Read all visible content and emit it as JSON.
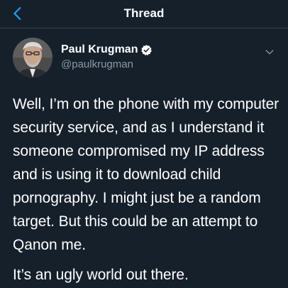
{
  "header": {
    "title": "Thread",
    "back_icon": "chevron-left-icon",
    "accent_color": "#1da1f2"
  },
  "author": {
    "display_name": "Paul Krugman",
    "handle": "@paulkrugman",
    "verified": true,
    "verified_icon": "verified-badge-icon",
    "caret_icon": "chevron-down-icon"
  },
  "tweet": {
    "paragraphs": [
      "Well, I’m on the phone with my computer security service, and as I understand it someone compromised my IP address and is using it to download child pornography. I might just be a random target. But this could be an attempt to Qanon me.",
      "It’s an ugly world out there."
    ]
  },
  "colors": {
    "background": "#15202b",
    "text_primary": "#ffffff",
    "text_secondary": "#8899a6",
    "divider": "#38444d"
  }
}
